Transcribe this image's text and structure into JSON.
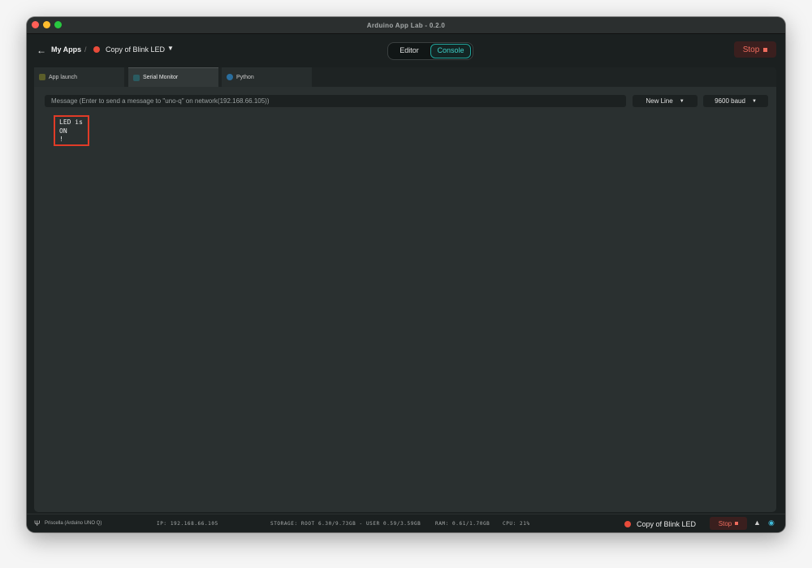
{
  "window": {
    "title": "Arduino App Lab - 0.2.0"
  },
  "appbar": {
    "back_label": "My Apps",
    "separator": "/",
    "app_name": "Copy of Blink LED",
    "view_toggle": {
      "editor": "Editor",
      "console": "Console",
      "selected": "Console"
    },
    "stop_label": "Stop"
  },
  "tabs": [
    {
      "label": "App launch",
      "icon": "app-launch-icon"
    },
    {
      "label": "Serial Monitor",
      "icon": "serial-monitor-icon",
      "active": true
    },
    {
      "label": "Python",
      "icon": "python-icon"
    }
  ],
  "serial": {
    "message_placeholder": "Message (Enter to send a message to \"uno-q\" on network(192.168.66.105))",
    "line_ending": "New Line",
    "baud_rate": "9600 baud",
    "output_lines": [
      "LED is",
      "ON",
      "!"
    ]
  },
  "status": {
    "board": "Priscella (Arduino UNO Q)",
    "ip": "IP: 192.168.66.105",
    "storage": "STORAGE: ROOT 6.30/9.73GB - USER 0.59/3.59GB",
    "ram": "RAM: 0.61/1.70GB",
    "cpu": "CPU: 21%",
    "app_name": "Copy of Blink LED",
    "stop_label": "Stop"
  },
  "colors": {
    "accent": "#3fd1c9",
    "stop": "#ef6b5d",
    "highlight_box": "#e03b27"
  }
}
